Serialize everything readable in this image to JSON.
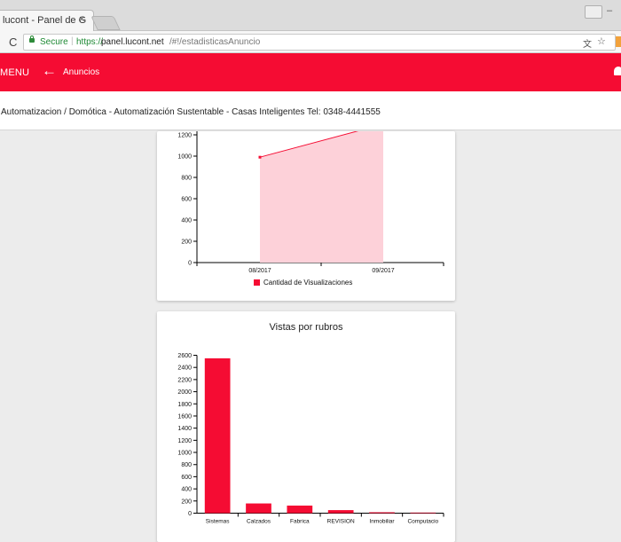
{
  "browser": {
    "tab_title": "lucont - Panel de G",
    "tab_close": "×",
    "url_secure_label": "Secure",
    "url_scheme": "https://",
    "url_host": "panel.lucont.net",
    "url_path": "/#!/estadisticasAnuncio"
  },
  "app_bar": {
    "menu_label": "MENU",
    "back_icon": "←",
    "section_title": "Anuncios",
    "accent_color": "#f50c33"
  },
  "company_line": "Automatizacion / Domótica - Automatización Sustentable - Casas Inteligentes Tel: 0348-4441555",
  "chart_data": [
    {
      "type": "area",
      "title": "",
      "categories": [
        "08/2017",
        "09/2017"
      ],
      "series": [
        {
          "name": "Cantidad de Visualizaciones",
          "values": [
            990,
            1300
          ]
        }
      ],
      "ylim": [
        0,
        1200
      ],
      "yticks": [
        0,
        200,
        400,
        600,
        800,
        1000,
        1200
      ],
      "ytick_labels": [
        "0",
        "200",
        "400",
        "600",
        "800",
        "1000",
        "1200"
      ],
      "legend": "bottom",
      "color": "#f50c33",
      "fill_color": "#fdd1d9"
    },
    {
      "type": "bar",
      "title": "Vistas por rubros",
      "categories": [
        "Sistemas",
        "Calzados",
        "Fabrica",
        "REVISION",
        "Inmobiliar",
        "Computacio"
      ],
      "values": [
        2550,
        160,
        125,
        50,
        15,
        10
      ],
      "ylim": [
        0,
        2600
      ],
      "yticks": [
        0,
        200,
        400,
        600,
        800,
        1000,
        1200,
        1400,
        1600,
        1800,
        2000,
        2200,
        2400,
        2600
      ],
      "ytick_labels": [
        "0",
        "200",
        "400",
        "600",
        "800",
        "1000",
        "1200",
        "1400",
        "1600",
        "1800",
        "2000",
        "2200",
        "2400",
        "2600"
      ],
      "color": "#f50c33"
    }
  ]
}
